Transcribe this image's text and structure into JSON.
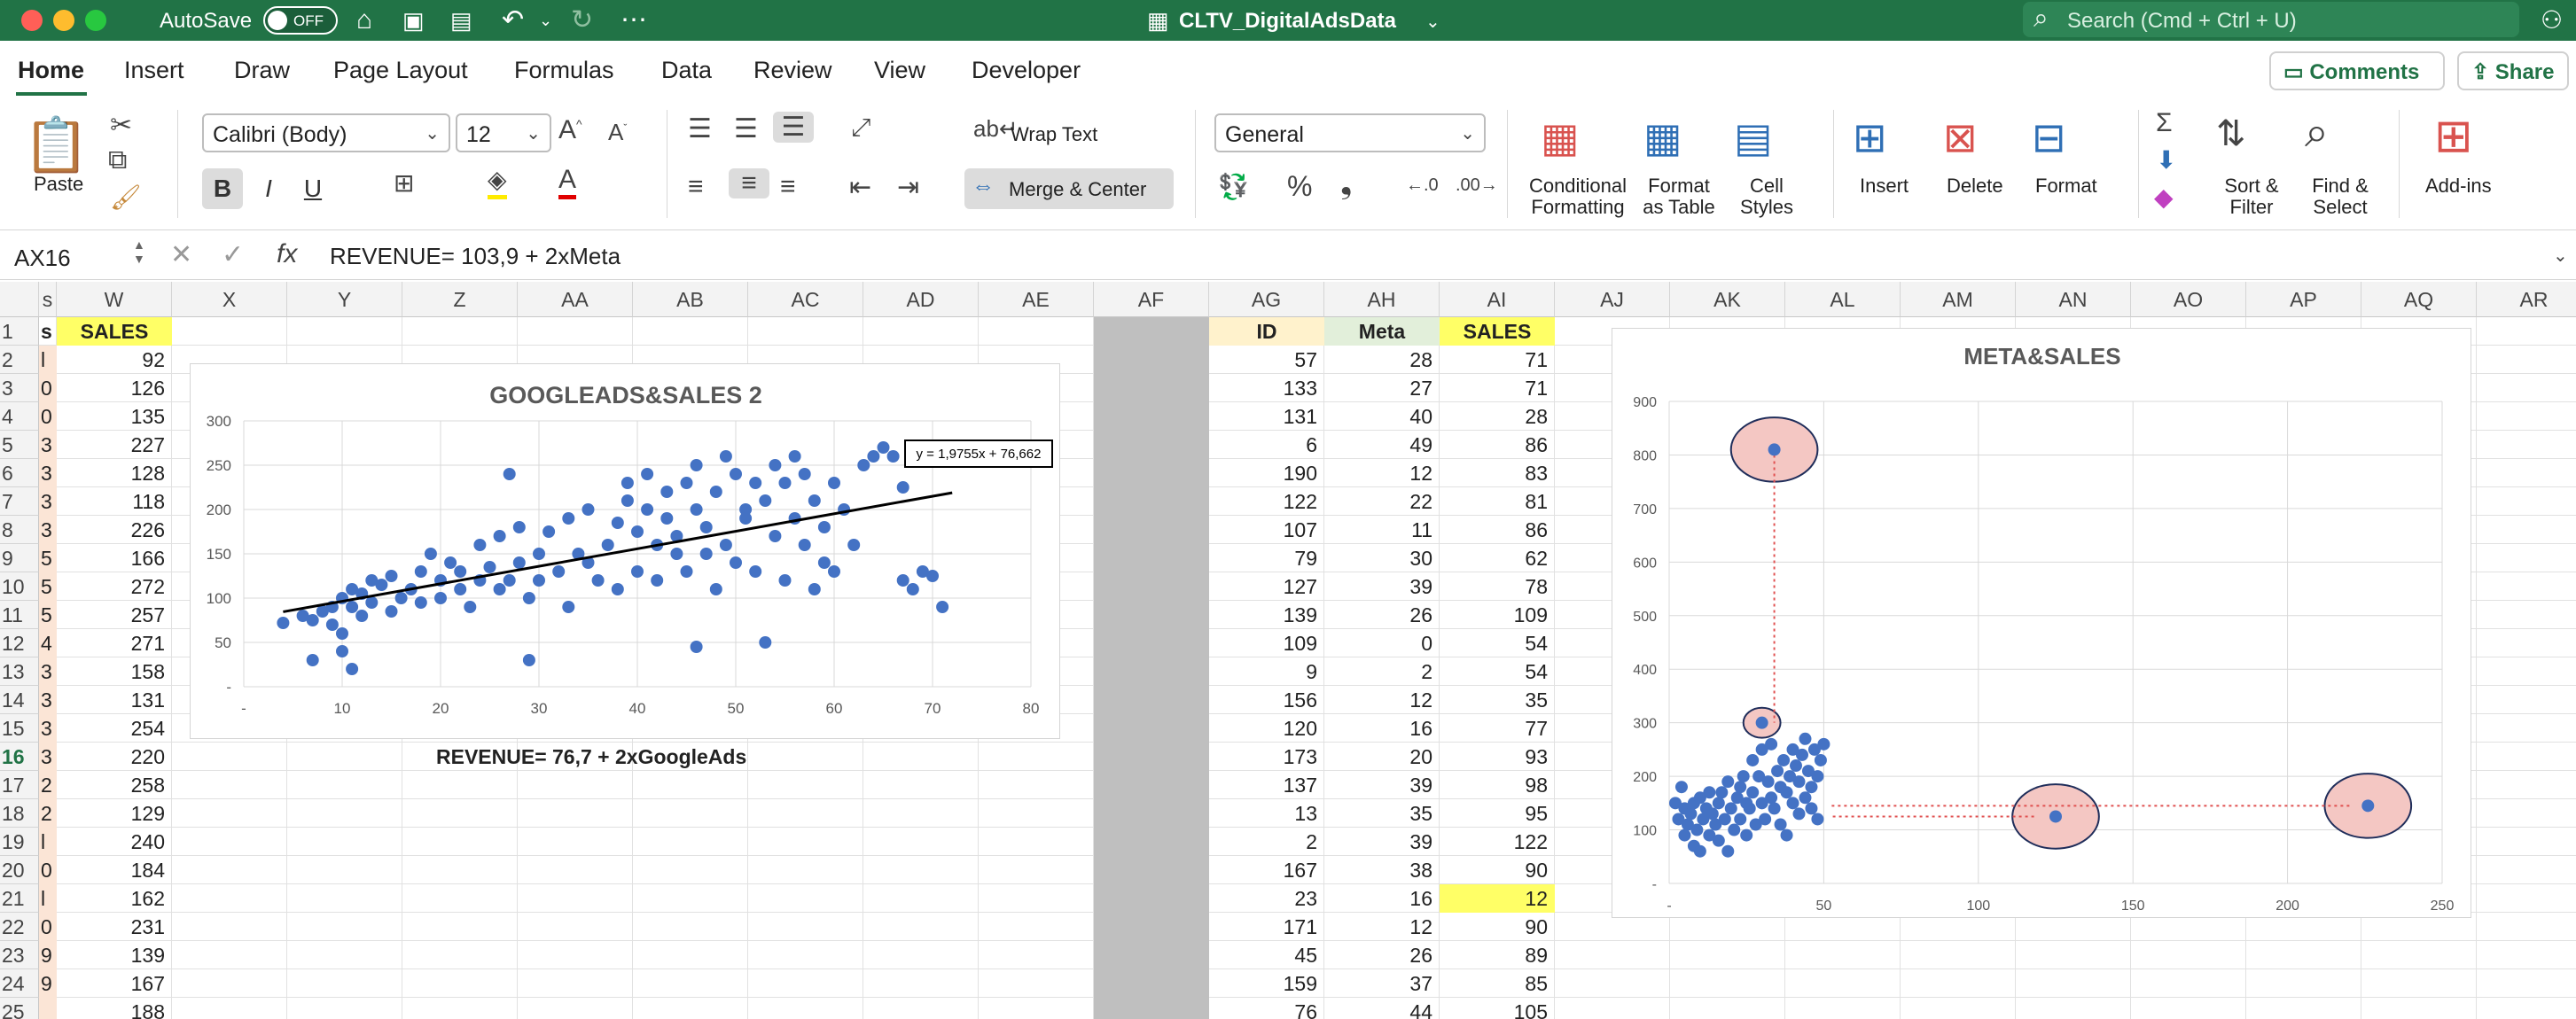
{
  "titlebar": {
    "autosave": "AutoSave",
    "toggle": "OFF",
    "filename": "CLTV_DigitalAdsData",
    "search_placeholder": "Search (Cmd + Ctrl + U)"
  },
  "menu": {
    "items": [
      "Home",
      "Insert",
      "Draw",
      "Page Layout",
      "Formulas",
      "Data",
      "Review",
      "View",
      "Developer"
    ],
    "comments": "Comments",
    "share": "Share"
  },
  "ribbon": {
    "paste": "Paste",
    "font_name": "Calibri (Body)",
    "font_size": "12",
    "wrap_text": "Wrap Text",
    "merge_center": "Merge & Center",
    "number_format": "General",
    "conditional": [
      "Conditional",
      "Formatting"
    ],
    "format_table": [
      "Format",
      "as Table"
    ],
    "cell_styles": [
      "Cell",
      "Styles"
    ],
    "insert": "Insert",
    "delete": "Delete",
    "format": "Format",
    "sort_filter": [
      "Sort &",
      "Filter"
    ],
    "find_select": [
      "Find &",
      "Select"
    ],
    "addins": "Add-ins",
    "bold": "B",
    "italic": "I",
    "underline": "U"
  },
  "formula": {
    "namebox": "AX16",
    "fx": "fx",
    "text": "REVENUE= 103,9 + 2xMeta"
  },
  "columns": [
    "s",
    "W",
    "X",
    "Y",
    "Z",
    "AA",
    "AB",
    "AC",
    "AD",
    "AE",
    "AF",
    "AG",
    "AH",
    "AI",
    "AJ",
    "AK",
    "AL",
    "AM",
    "AN",
    "AO",
    "AP",
    "AQ",
    "AR"
  ],
  "rows": [
    "1",
    "2",
    "3",
    "4",
    "5",
    "6",
    "7",
    "8",
    "9",
    "10",
    "11",
    "12",
    "13",
    "14",
    "15",
    "16",
    "17",
    "18",
    "19",
    "20",
    "21",
    "22",
    "23",
    "24",
    "25"
  ],
  "left_table": {
    "header_v": "s",
    "header_w": "SALES",
    "v_cut": [
      "l",
      "0",
      "0",
      "3",
      "3",
      "3",
      "3",
      "5",
      "5",
      "5",
      "4",
      "3",
      "3",
      "3",
      "3",
      "2",
      "2",
      "l",
      "0",
      "l",
      "0",
      "9",
      "9",
      ""
    ],
    "w": [
      "92",
      "126",
      "135",
      "227",
      "128",
      "118",
      "226",
      "166",
      "272",
      "257",
      "271",
      "158",
      "131",
      "254",
      "220",
      "258",
      "129",
      "240",
      "184",
      "162",
      "231",
      "139",
      "167",
      "188"
    ]
  },
  "right_table": {
    "headers": [
      "ID",
      "Meta",
      "SALES"
    ],
    "rows": [
      [
        "57",
        "28",
        "71"
      ],
      [
        "133",
        "27",
        "71"
      ],
      [
        "131",
        "40",
        "28"
      ],
      [
        "6",
        "49",
        "86"
      ],
      [
        "190",
        "12",
        "83"
      ],
      [
        "122",
        "22",
        "81"
      ],
      [
        "107",
        "11",
        "86"
      ],
      [
        "79",
        "30",
        "62"
      ],
      [
        "127",
        "39",
        "78"
      ],
      [
        "139",
        "26",
        "109"
      ],
      [
        "109",
        "0",
        "54"
      ],
      [
        "9",
        "2",
        "54"
      ],
      [
        "156",
        "12",
        "35"
      ],
      [
        "120",
        "16",
        "77"
      ],
      [
        "173",
        "20",
        "93"
      ],
      [
        "137",
        "39",
        "98"
      ],
      [
        "13",
        "35",
        "95"
      ],
      [
        "2",
        "39",
        "122"
      ],
      [
        "167",
        "38",
        "90"
      ],
      [
        "23",
        "16",
        "12"
      ],
      [
        "171",
        "12",
        "90"
      ],
      [
        "45",
        "26",
        "89"
      ],
      [
        "159",
        "37",
        "85"
      ],
      [
        "76",
        "44",
        "105"
      ]
    ]
  },
  "revenue_google": "REVENUE= 76,7 + 2xGoogleAds",
  "chart_data": [
    {
      "type": "scatter",
      "title": "GOOGLEADS&SALES 2",
      "xlim": [
        0,
        80
      ],
      "ylim": [
        0,
        300
      ],
      "x_ticks": [
        "-",
        "10",
        "20",
        "30",
        "40",
        "50",
        "60",
        "70",
        "80"
      ],
      "y_ticks": [
        "-",
        "50",
        "100",
        "150",
        "200",
        "250",
        "300"
      ],
      "trendline_label": "y = 1,9755x + 76,662",
      "trendline": {
        "slope": 1.9755,
        "intercept": 76.662,
        "x_range": [
          4,
          72
        ]
      },
      "points": [
        [
          4,
          72
        ],
        [
          6,
          80
        ],
        [
          7,
          30
        ],
        [
          7,
          75
        ],
        [
          8,
          85
        ],
        [
          9,
          90
        ],
        [
          9,
          70
        ],
        [
          10,
          100
        ],
        [
          10,
          60
        ],
        [
          10,
          40
        ],
        [
          11,
          90
        ],
        [
          11,
          110
        ],
        [
          11,
          20
        ],
        [
          12,
          80
        ],
        [
          12,
          105
        ],
        [
          13,
          120
        ],
        [
          13,
          95
        ],
        [
          14,
          115
        ],
        [
          15,
          85
        ],
        [
          15,
          125
        ],
        [
          16,
          100
        ],
        [
          17,
          110
        ],
        [
          18,
          95
        ],
        [
          18,
          130
        ],
        [
          19,
          150
        ],
        [
          20,
          120
        ],
        [
          20,
          100
        ],
        [
          21,
          140
        ],
        [
          22,
          110
        ],
        [
          22,
          130
        ],
        [
          23,
          90
        ],
        [
          24,
          120
        ],
        [
          24,
          160
        ],
        [
          25,
          135
        ],
        [
          26,
          110
        ],
        [
          26,
          170
        ],
        [
          27,
          120
        ],
        [
          27,
          240
        ],
        [
          28,
          140
        ],
        [
          28,
          180
        ],
        [
          29,
          100
        ],
        [
          29,
          30
        ],
        [
          30,
          150
        ],
        [
          30,
          120
        ],
        [
          31,
          175
        ],
        [
          32,
          130
        ],
        [
          33,
          190
        ],
        [
          33,
          90
        ],
        [
          34,
          150
        ],
        [
          35,
          200
        ],
        [
          35,
          140
        ],
        [
          36,
          120
        ],
        [
          37,
          160
        ],
        [
          38,
          185
        ],
        [
          38,
          110
        ],
        [
          39,
          210
        ],
        [
          39,
          230
        ],
        [
          40,
          175
        ],
        [
          40,
          130
        ],
        [
          41,
          240
        ],
        [
          41,
          200
        ],
        [
          42,
          160
        ],
        [
          42,
          120
        ],
        [
          43,
          190
        ],
        [
          43,
          220
        ],
        [
          44,
          150
        ],
        [
          44,
          170
        ],
        [
          45,
          230
        ],
        [
          45,
          130
        ],
        [
          46,
          250
        ],
        [
          46,
          45
        ],
        [
          46,
          200
        ],
        [
          47,
          180
        ],
        [
          47,
          150
        ],
        [
          48,
          220
        ],
        [
          48,
          110
        ],
        [
          49,
          260
        ],
        [
          49,
          160
        ],
        [
          50,
          240
        ],
        [
          50,
          140
        ],
        [
          51,
          190
        ],
        [
          51,
          200
        ],
        [
          52,
          230
        ],
        [
          52,
          130
        ],
        [
          53,
          50
        ],
        [
          53,
          210
        ],
        [
          54,
          170
        ],
        [
          54,
          250
        ],
        [
          55,
          230
        ],
        [
          55,
          120
        ],
        [
          56,
          190
        ],
        [
          56,
          260
        ],
        [
          57,
          160
        ],
        [
          57,
          240
        ],
        [
          58,
          210
        ],
        [
          58,
          110
        ],
        [
          59,
          180
        ],
        [
          59,
          140
        ],
        [
          60,
          230
        ],
        [
          60,
          130
        ],
        [
          61,
          200
        ],
        [
          62,
          160
        ],
        [
          63,
          250
        ],
        [
          64,
          260
        ],
        [
          65,
          270
        ],
        [
          66,
          260
        ],
        [
          67,
          225
        ],
        [
          67,
          120
        ],
        [
          68,
          110
        ],
        [
          69,
          130
        ],
        [
          70,
          125
        ],
        [
          71,
          90
        ]
      ]
    },
    {
      "type": "scatter",
      "title": "META&SALES",
      "xlim": [
        0,
        250
      ],
      "ylim": [
        0,
        900
      ],
      "x_ticks": [
        "-",
        "50",
        "100",
        "150",
        "200",
        "250"
      ],
      "y_ticks": [
        "-",
        "100",
        "200",
        "300",
        "400",
        "500",
        "600",
        "700",
        "800",
        "900"
      ],
      "points": [
        [
          2,
          150
        ],
        [
          3,
          120
        ],
        [
          4,
          180
        ],
        [
          5,
          90
        ],
        [
          5,
          140
        ],
        [
          6,
          110
        ],
        [
          7,
          130
        ],
        [
          8,
          70
        ],
        [
          8,
          150
        ],
        [
          9,
          100
        ],
        [
          10,
          160
        ],
        [
          10,
          60
        ],
        [
          11,
          120
        ],
        [
          12,
          140
        ],
        [
          13,
          90
        ],
        [
          13,
          170
        ],
        [
          14,
          130
        ],
        [
          15,
          110
        ],
        [
          16,
          150
        ],
        [
          16,
          80
        ],
        [
          17,
          170
        ],
        [
          18,
          120
        ],
        [
          19,
          60
        ],
        [
          19,
          190
        ],
        [
          20,
          140
        ],
        [
          21,
          100
        ],
        [
          22,
          160
        ],
        [
          23,
          180
        ],
        [
          23,
          120
        ],
        [
          24,
          200
        ],
        [
          25,
          90
        ],
        [
          25,
          150
        ],
        [
          26,
          140
        ],
        [
          27,
          170
        ],
        [
          27,
          230
        ],
        [
          28,
          110
        ],
        [
          29,
          200
        ],
        [
          30,
          150
        ],
        [
          30,
          250
        ],
        [
          31,
          120
        ],
        [
          32,
          190
        ],
        [
          33,
          160
        ],
        [
          33,
          260
        ],
        [
          34,
          140
        ],
        [
          35,
          210
        ],
        [
          36,
          180
        ],
        [
          36,
          110
        ],
        [
          37,
          230
        ],
        [
          38,
          170
        ],
        [
          38,
          90
        ],
        [
          39,
          200
        ],
        [
          40,
          150
        ],
        [
          40,
          250
        ],
        [
          41,
          220
        ],
        [
          42,
          130
        ],
        [
          42,
          190
        ],
        [
          43,
          240
        ],
        [
          44,
          160
        ],
        [
          44,
          270
        ],
        [
          45,
          210
        ],
        [
          46,
          180
        ],
        [
          46,
          140
        ],
        [
          47,
          250
        ],
        [
          48,
          200
        ],
        [
          48,
          120
        ],
        [
          49,
          230
        ],
        [
          50,
          260
        ],
        [
          30,
          300
        ],
        [
          34,
          810
        ],
        [
          125,
          125
        ],
        [
          226,
          145
        ]
      ],
      "circles": [
        [
          34,
          810,
          14,
          60
        ],
        [
          30,
          300,
          6,
          28
        ],
        [
          125,
          125,
          14,
          60
        ],
        [
          226,
          145,
          14,
          60
        ]
      ]
    }
  ]
}
